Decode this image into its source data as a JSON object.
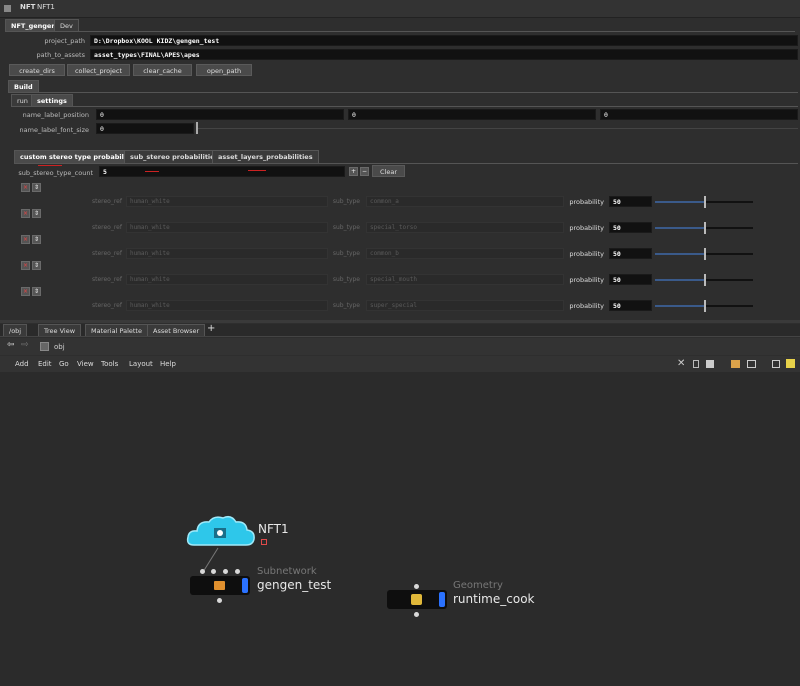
{
  "window": {
    "type_label": "NFT",
    "node_name": "NFT1"
  },
  "top_tabs": [
    "NFT_gengen",
    "Dev"
  ],
  "params": {
    "project_path": {
      "label": "project_path",
      "value": "D:\\Dropbox\\KOOL KIDZ\\gengen_test"
    },
    "path_to_assets": {
      "label": "path_to_assets",
      "value": "asset_types\\FINAL\\APES\\apes"
    }
  },
  "buttons": {
    "create_dirs": "create_dirs",
    "collect_project": "collect_project",
    "clear_cache": "clear_cache",
    "open_path": "open_path"
  },
  "build_tab": "Build",
  "build_subtabs": [
    "run",
    "settings"
  ],
  "name_label_position": {
    "label": "name_label_position",
    "values": [
      "0",
      "0",
      "0"
    ]
  },
  "name_label_font_size": {
    "label": "name_label_font_size",
    "value": "0"
  },
  "prob_tabs": [
    "custom stereo type probabilites",
    "sub_stereo probabilities",
    "asset_layers_probabilities"
  ],
  "sub_stereo_type_count": {
    "label": "sub_stereo_type_count",
    "value": "5",
    "clear_label": "Clear",
    "plus": "+",
    "minus": "−"
  },
  "row_labels": {
    "stereo_ref": "stereo_ref",
    "sub_type": "sub_type",
    "probability": "probability",
    "x": "×",
    "move": "⇕"
  },
  "rows": [
    {
      "stereo_ref": "human_white",
      "sub_type": "common_a",
      "probability": "50"
    },
    {
      "stereo_ref": "human_white",
      "sub_type": "special_torso",
      "probability": "50"
    },
    {
      "stereo_ref": "human_white",
      "sub_type": "common_b",
      "probability": "50"
    },
    {
      "stereo_ref": "human_white",
      "sub_type": "special_mouth",
      "probability": "50"
    },
    {
      "stereo_ref": "human_white",
      "sub_type": "super_special",
      "probability": "50"
    }
  ],
  "pane_tabs": [
    "/obj",
    "Tree View",
    "Material Palette",
    "Asset Browser"
  ],
  "path": "obj",
  "menus": [
    "Add",
    "Edit",
    "Go",
    "View",
    "Tools",
    "Layout",
    "Help"
  ],
  "nodes": {
    "nft": {
      "name": "NFT1"
    },
    "gengen": {
      "type": "Subnetwork",
      "name": "gengen_test"
    },
    "runtime": {
      "type": "Geometry",
      "name": "runtime_cook"
    }
  },
  "colors": {
    "accent": "#3a5a8a",
    "cloud": "#2ec7ea",
    "flag": "#2b72ff"
  }
}
